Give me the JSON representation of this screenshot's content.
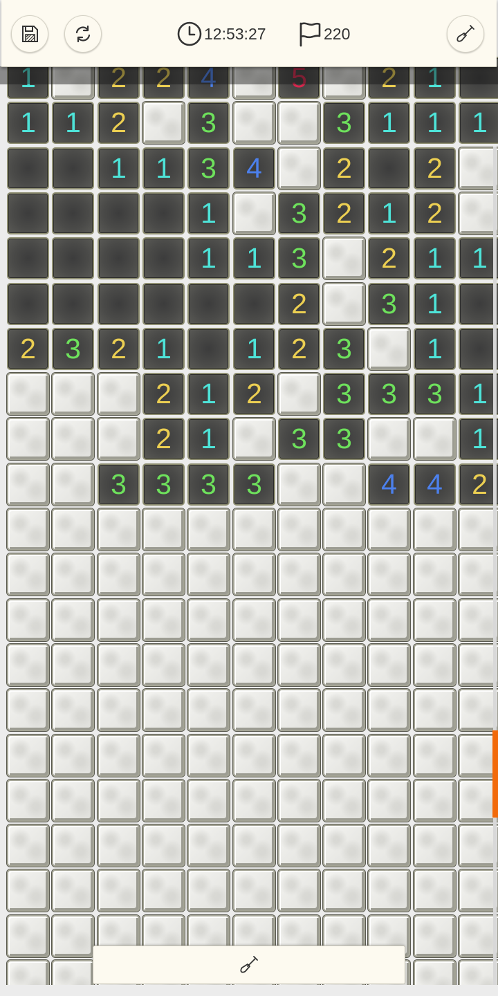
{
  "header": {
    "timer": "12:53:27",
    "flags_remaining": "220",
    "save_icon": "floppy-disk-icon",
    "restart_icon": "refresh-icon",
    "tool_icon": "shovel-icon"
  },
  "bottom_bar": {
    "tool_icon": "shovel-icon"
  },
  "colors": {
    "number_1": "#4ee3d8",
    "number_2": "#eccf52",
    "number_3": "#6ee15c",
    "number_4": "#4c80ec",
    "number_5": "#d6284e",
    "scroll_indicator": "#f26a0a"
  },
  "board": {
    "columns": 11,
    "legend": "C = closed tile, . = opened empty tile, digit = opened tile with adjacent-mine count",
    "rows": [
      "1C224C5C21.",
      "112C3CC3111",
      "..1134C2.2C",
      "....1C3212C",
      "....113C211",
      "......2C31.",
      "2321.123C1.",
      "CCC212C3331",
      "CCC21C33CC1",
      "CC3333CC442",
      "CCCCCCCCCCC",
      "CCCCCCCCCCC",
      "CCCCCCCCCCC",
      "CCCCCCCCCCC",
      "CCCCCCCCCCC",
      "CCCCCCCCCCC",
      "CCCCCCCCCCC",
      "CCCCCCCCCCC",
      "CCCCCCCCCCC",
      "CCCCCCCCCCC",
      "CCCCCCCCCCC"
    ]
  }
}
